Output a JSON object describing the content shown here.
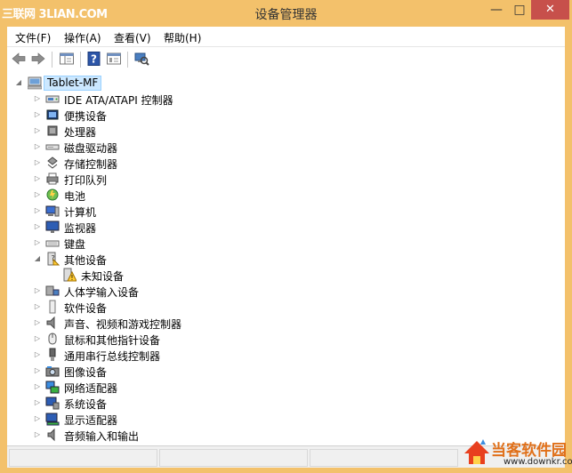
{
  "watermark_top": "三联网 3LIAN.COM",
  "window": {
    "title": "设备管理器",
    "minimize": "—",
    "maximize": "□",
    "close": "✕"
  },
  "menu": [
    "文件(F)",
    "操作(A)",
    "查看(V)",
    "帮助(H)"
  ],
  "toolbar": [
    "back-icon",
    "forward-icon",
    "show-hide-console-tree-icon",
    "help-icon",
    "properties-icon",
    "scan-hardware-icon"
  ],
  "tree": {
    "root": "Tablet-MF",
    "items": [
      {
        "label": "IDE ATA/ATAPI 控制器",
        "icon": "ide-controller-icon",
        "expander": "▷"
      },
      {
        "label": "便携设备",
        "icon": "portable-device-icon",
        "expander": "▷"
      },
      {
        "label": "处理器",
        "icon": "processor-icon",
        "expander": "▷"
      },
      {
        "label": "磁盘驱动器",
        "icon": "disk-drive-icon",
        "expander": "▷"
      },
      {
        "label": "存储控制器",
        "icon": "storage-controller-icon",
        "expander": "▷"
      },
      {
        "label": "打印队列",
        "icon": "print-queue-icon",
        "expander": "▷"
      },
      {
        "label": "电池",
        "icon": "battery-icon",
        "expander": "▷"
      },
      {
        "label": "计算机",
        "icon": "computer-icon",
        "expander": "▷"
      },
      {
        "label": "监视器",
        "icon": "monitor-icon",
        "expander": "▷"
      },
      {
        "label": "键盘",
        "icon": "keyboard-icon",
        "expander": "▷"
      },
      {
        "label": "其他设备",
        "icon": "other-devices-icon",
        "expander": "◢"
      },
      {
        "label": "未知设备",
        "icon": "unknown-device-warning-icon",
        "expander": ""
      },
      {
        "label": "人体学输入设备",
        "icon": "hid-icon",
        "expander": "▷"
      },
      {
        "label": "软件设备",
        "icon": "software-device-icon",
        "expander": "▷"
      },
      {
        "label": "声音、视频和游戏控制器",
        "icon": "sound-icon",
        "expander": "▷"
      },
      {
        "label": "鼠标和其他指针设备",
        "icon": "mouse-icon",
        "expander": "▷"
      },
      {
        "label": "通用串行总线控制器",
        "icon": "usb-icon",
        "expander": "▷"
      },
      {
        "label": "图像设备",
        "icon": "imaging-device-icon",
        "expander": "▷"
      },
      {
        "label": "网络适配器",
        "icon": "network-adapter-icon",
        "expander": "▷"
      },
      {
        "label": "系统设备",
        "icon": "system-device-icon",
        "expander": "▷"
      },
      {
        "label": "显示适配器",
        "icon": "display-adapter-icon",
        "expander": "▷"
      },
      {
        "label": "音频输入和输出",
        "icon": "audio-io-icon",
        "expander": "▷"
      }
    ]
  },
  "watermark_bottom": {
    "brand": "当客软件园",
    "url": "www.downkr.com"
  },
  "colors": {
    "frame": "#f3c16b",
    "close": "#c7504b",
    "selection": "#cce8ff"
  }
}
